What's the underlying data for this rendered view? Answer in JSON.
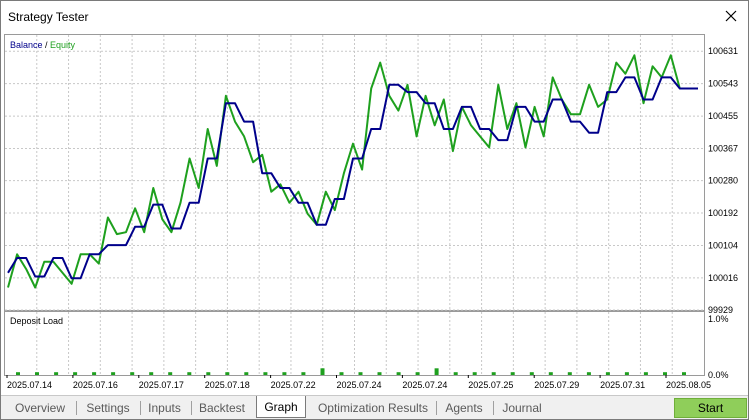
{
  "window": {
    "title": "Strategy Tester",
    "close_icon": "close-icon"
  },
  "chart_data": [
    {
      "type": "line",
      "legend": {
        "balance": "Balance",
        "sep": " / ",
        "equity": "Equity",
        "placement": "top-left"
      },
      "colors": {
        "balance": "#00008b",
        "equity": "#1ea01e",
        "grid": "#c8c8c8",
        "axis_text": "#000000"
      },
      "y_ticks": [
        "100631",
        "100543",
        "100455",
        "100367",
        "100280",
        "100192",
        "100104",
        "100016",
        "99929"
      ],
      "ylim": [
        99929,
        100675
      ],
      "grid": true,
      "x_tick_labels": [
        "2025.07.14",
        "2025.07.16",
        "2025.07.17",
        "2025.07.18",
        "2025.07.22",
        "2025.07.24",
        "2025.07.24",
        "2025.07.25",
        "2025.07.29",
        "2025.07.31",
        "2025.08.05"
      ],
      "series": [
        {
          "name": "Balance",
          "values": [
            100030,
            100070,
            100070,
            100020,
            100020,
            100070,
            100070,
            100015,
            100015,
            100080,
            100080,
            100105,
            100105,
            100105,
            100155,
            100155,
            100215,
            100215,
            100150,
            100150,
            100220,
            100220,
            100340,
            100340,
            100490,
            100490,
            100440,
            100440,
            100300,
            100300,
            100260,
            100260,
            100220,
            100220,
            100160,
            100160,
            100230,
            100230,
            100340,
            100340,
            100420,
            100420,
            100540,
            100540,
            100520,
            100520,
            100490,
            100490,
            100420,
            100420,
            100480,
            100480,
            100420,
            100420,
            100390,
            100390,
            100480,
            100480,
            100440,
            100440,
            100500,
            100500,
            100440,
            100440,
            100410,
            100410,
            100520,
            100520,
            100560,
            100560,
            100500,
            100500,
            100560,
            100560,
            100530,
            100530,
            100530
          ]
        },
        {
          "name": "Equity",
          "values": [
            99990,
            100080,
            100040,
            99990,
            100060,
            100060,
            100030,
            100000,
            100080,
            100080,
            100055,
            100180,
            100135,
            100140,
            100205,
            100140,
            100260,
            100175,
            100140,
            100220,
            100340,
            100260,
            100420,
            100320,
            100510,
            100440,
            100400,
            100330,
            100350,
            100250,
            100270,
            100220,
            100250,
            100190,
            100160,
            100250,
            100200,
            100300,
            100380,
            100310,
            100530,
            100600,
            100510,
            100470,
            100540,
            100400,
            100510,
            100430,
            100500,
            100360,
            100480,
            100430,
            100400,
            100370,
            100540,
            100420,
            100490,
            100370,
            100480,
            100400,
            100560,
            100500,
            100460,
            100460,
            100540,
            100480,
            100500,
            100600,
            100570,
            100620,
            100490,
            100590,
            100560,
            100620,
            100530,
            100530,
            100530
          ]
        }
      ]
    },
    {
      "type": "bar",
      "title": "Deposit Load",
      "y_ticks": [
        "1.0%",
        "0.0%"
      ],
      "ylim": [
        0,
        1.0
      ],
      "values": [
        0.05,
        0.05,
        0.05,
        0.05,
        0.05,
        0.05,
        0.05,
        0.05,
        0.05,
        0.05,
        0.05,
        0.05,
        0.05,
        0.05,
        0.05,
        0.05,
        0.12,
        0.05,
        0.05,
        0.05,
        0.05,
        0.05,
        0.12,
        0.05,
        0.05,
        0.05,
        0.05,
        0.05,
        0.05,
        0.05,
        0.05,
        0.05,
        0.05,
        0.05,
        0.05,
        0.05
      ]
    }
  ],
  "tabs": [
    {
      "label": "Overview",
      "active": false
    },
    {
      "label": "Settings",
      "active": false
    },
    {
      "label": "Inputs",
      "active": false
    },
    {
      "label": "Backtest",
      "active": false
    },
    {
      "label": "Graph",
      "active": true
    },
    {
      "label": "Optimization Results",
      "active": false
    },
    {
      "label": "Agents",
      "active": false
    },
    {
      "label": "Journal",
      "active": false
    }
  ],
  "start_button": {
    "label": "Start",
    "color": "#8fce5a"
  }
}
